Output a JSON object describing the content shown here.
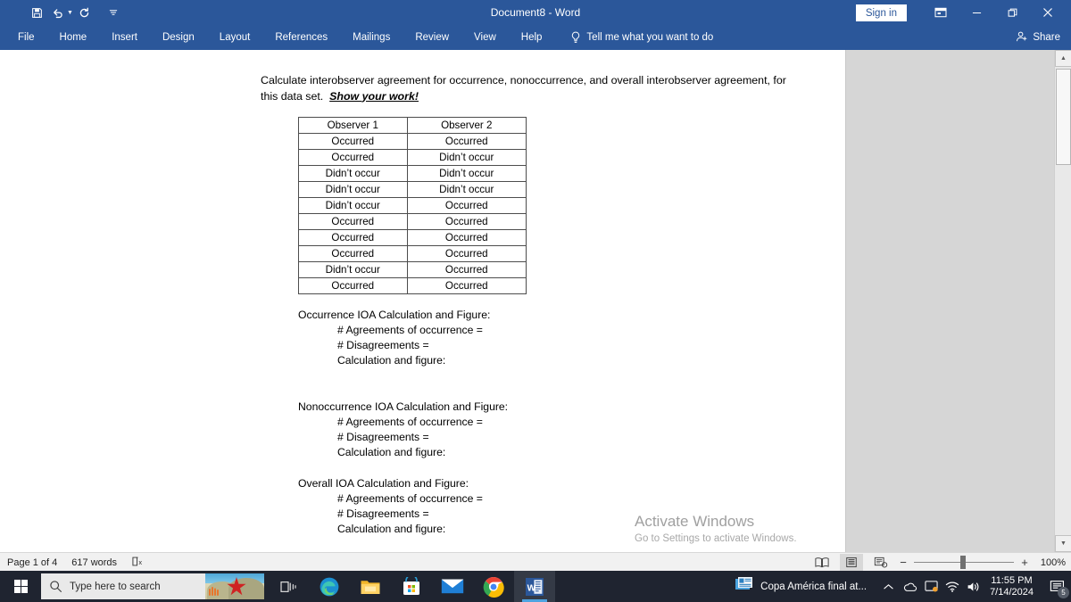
{
  "titlebar": {
    "document_title": "Document8  -  Word",
    "quick_access": [
      {
        "name": "save-icon",
        "glyph": "ὋE"
      },
      {
        "name": "undo-icon",
        "glyph": "↶"
      },
      {
        "name": "redo-icon",
        "glyph": "↻"
      },
      {
        "name": "customize-qat-icon",
        "glyph": "≡"
      }
    ],
    "sign_in_label": "Sign in",
    "ribbon_display_options": "Ribbon Display Options",
    "minimize": "Minimize",
    "restore": "Restore Down",
    "close": "Close",
    "accent_color": "#2b579a"
  },
  "ribbon": {
    "tabs": [
      {
        "label": "File"
      },
      {
        "label": "Home"
      },
      {
        "label": "Insert"
      },
      {
        "label": "Design"
      },
      {
        "label": "Layout"
      },
      {
        "label": "References"
      },
      {
        "label": "Mailings"
      },
      {
        "label": "Review"
      },
      {
        "label": "View"
      },
      {
        "label": "Help"
      }
    ],
    "tell_me": "Tell me what you want to do",
    "share_label": "Share"
  },
  "document": {
    "intro_line1": "Calculate interobserver agreement for occurrence, nonoccurrence, and overall interobserver agreement,",
    "intro_line2_prefix": "for this data set.  ",
    "intro_emphasis": "Show your work!",
    "table": {
      "headers": [
        "Observer 1",
        "Observer 2"
      ],
      "rows": [
        [
          "Occurred",
          "Occurred"
        ],
        [
          "Occurred",
          "Didn’t occur"
        ],
        [
          "Didn’t occur",
          "Didn’t occur"
        ],
        [
          "Didn’t occur",
          "Didn’t occur"
        ],
        [
          "Didn’t occur",
          "Occurred"
        ],
        [
          "Occurred",
          "Occurred"
        ],
        [
          "Occurred",
          "Occurred"
        ],
        [
          "Occurred",
          "Occurred"
        ],
        [
          "Didn’t occur",
          "Occurred"
        ],
        [
          "Occurred",
          "Occurred"
        ]
      ]
    },
    "sections": [
      {
        "heading": "Occurrence IOA Calculation and Figure:",
        "lines": [
          "# Agreements of occurrence =",
          "# Disagreements =",
          "Calculation and figure:"
        ]
      },
      {
        "heading": "Nonoccurrence IOA Calculation and Figure:",
        "lines": [
          "# Agreements of occurrence =",
          "# Disagreements =",
          "Calculation and figure:"
        ]
      },
      {
        "heading": "Overall IOA Calculation and Figure:",
        "lines": [
          "# Agreements of occurrence =",
          "# Disagreements =",
          "Calculation and figure:"
        ]
      }
    ]
  },
  "watermark": {
    "title": "Activate Windows",
    "subtitle": "Go to Settings to activate Windows."
  },
  "statusbar": {
    "page": "Page 1 of 4",
    "words": "617 words",
    "proofing_icon": "proofing-errors-icon",
    "views": [
      {
        "name": "read-mode-view-button",
        "label": "Read Mode"
      },
      {
        "name": "print-layout-view-button",
        "label": "Print Layout"
      },
      {
        "name": "web-layout-view-button",
        "label": "Web Layout"
      }
    ],
    "zoom_out": "−",
    "zoom_in": "+",
    "zoom_level": "100%"
  },
  "taskbar": {
    "start": "Start",
    "search_placeholder": "Type here to search",
    "apps": [
      {
        "name": "task-view-icon",
        "label": "Task View",
        "running": false
      },
      {
        "name": "microsoft-edge-icon",
        "label": "Microsoft Edge",
        "running": true
      },
      {
        "name": "file-explorer-icon",
        "label": "File Explorer",
        "running": true
      },
      {
        "name": "microsoft-store-icon",
        "label": "Microsoft Store",
        "running": false
      },
      {
        "name": "mail-icon",
        "label": "Mail",
        "running": true
      },
      {
        "name": "google-chrome-icon",
        "label": "Google Chrome",
        "running": true
      },
      {
        "name": "microsoft-word-icon",
        "label": "Word",
        "running": true
      }
    ],
    "news_headline": "Copa América final at...",
    "time": "11:55 PM",
    "date": "7/14/2024",
    "notification_count": "5",
    "tray_icons": [
      "show-hidden-icons-chevron",
      "onedrive-icon",
      "action-center-sync-icon",
      "network-icon",
      "volume-icon"
    ]
  }
}
